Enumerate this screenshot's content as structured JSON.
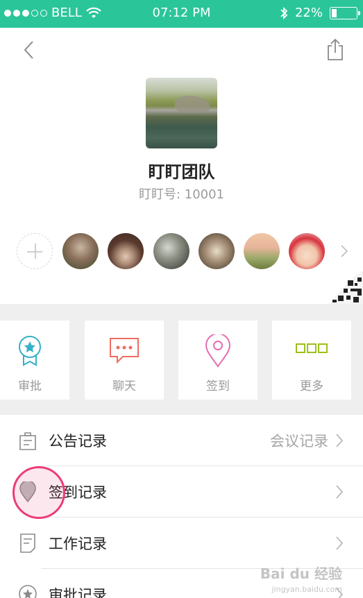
{
  "status_bar": {
    "carrier": "BELL",
    "time": "07:12 PM",
    "battery": "22%",
    "battery_level": 0.22
  },
  "header": {
    "back_icon": "chevron-left-icon",
    "share_icon": "share-icon"
  },
  "team": {
    "name": "盯盯团队",
    "id_text": "盯盯号: 10001"
  },
  "members": {
    "add_icon": "plus-icon",
    "count_shown": 6,
    "more_icon": "chevron-right-icon",
    "qr_icon": "qr-code-icon"
  },
  "tiles": [
    {
      "label": "审批",
      "icon": "approval-badge-icon",
      "color": "#33b1c7"
    },
    {
      "label": "聊天",
      "icon": "chat-bubble-icon",
      "color": "#ef6c5f"
    },
    {
      "label": "签到",
      "icon": "location-pin-icon",
      "color": "#e56db1"
    },
    {
      "label": "更多",
      "icon": "more-squares-icon",
      "color": "#9dbf1a"
    }
  ],
  "list": [
    {
      "label": "公告记录",
      "value": "会议记录",
      "icon": "notice-icon"
    },
    {
      "label": "签到记录",
      "value": "",
      "icon": "location-pin-icon"
    },
    {
      "label": "工作记录",
      "value": "",
      "icon": "document-icon"
    },
    {
      "label": "审批记录",
      "value": "",
      "icon": "star-badge-icon"
    }
  ],
  "watermark": {
    "text": "Bai du 经验",
    "sub": "jingyan.baidu.com"
  }
}
